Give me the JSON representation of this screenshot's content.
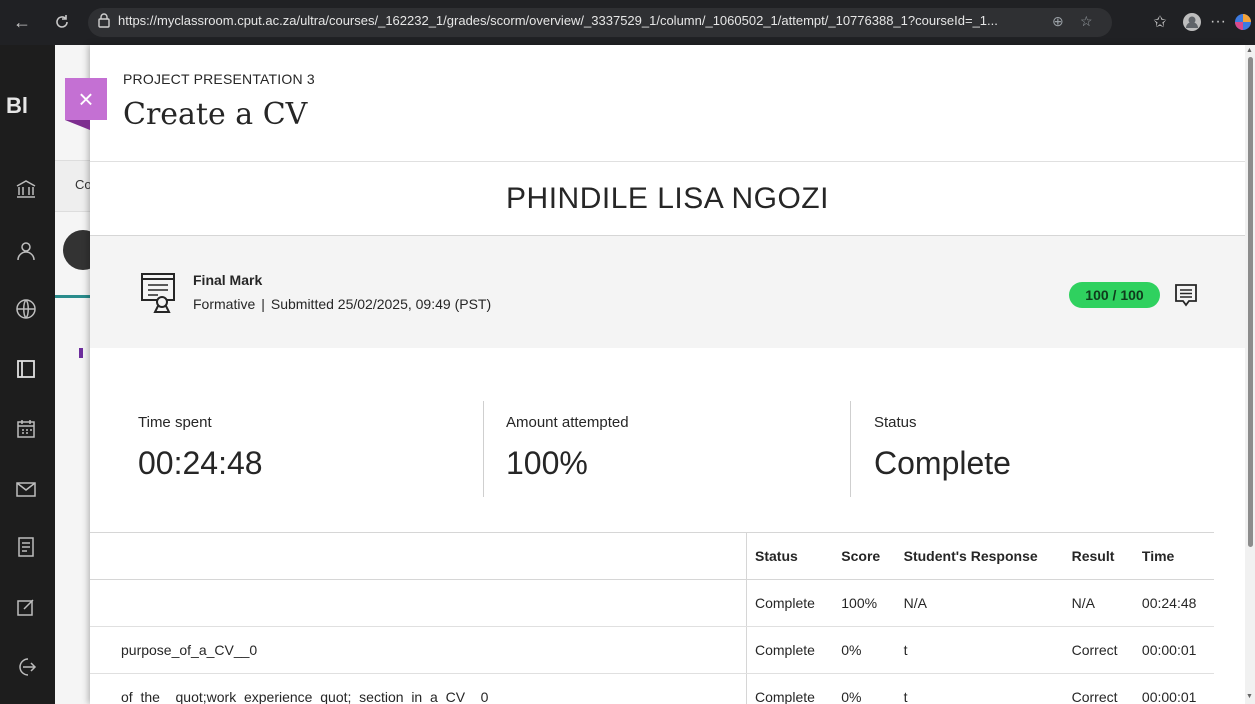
{
  "browser": {
    "url": "https://myclassroom.cput.ac.za/ultra/courses/_162232_1/grades/scorm/overview/_3337529_1/column/_1060502_1/attempt/_10776388_1?courseId=_1...",
    "back_icon": "back-arrow-icon",
    "refresh_icon": "refresh-icon",
    "lock_icon": "lock-icon"
  },
  "sidebar": {
    "logo": "Bl",
    "icons": [
      "institution-icon",
      "profile-icon",
      "globe-icon",
      "courses-icon",
      "calendar-icon",
      "messages-icon",
      "grades-icon",
      "tools-icon",
      "signout-icon"
    ]
  },
  "background_page": {
    "tab_text": "Co"
  },
  "panel": {
    "breadcrumb": "PROJECT PRESENTATION 3",
    "title": "Create a CV",
    "close_label": "×",
    "student_name": "PHINDILE LISA NGOZI",
    "grade": {
      "label": "Final Mark",
      "type": "Formative",
      "submitted": "Submitted 25/02/2025, 09:49 (PST)",
      "score": "100 / 100"
    },
    "stats": [
      {
        "label": "Time spent",
        "value": "00:24:48"
      },
      {
        "label": "Amount attempted",
        "value": "100%"
      },
      {
        "label": "Status",
        "value": "Complete"
      }
    ],
    "table": {
      "headers": [
        "",
        "Status",
        "Score",
        "Student's Response",
        "Result",
        "Time"
      ],
      "rows": [
        [
          "",
          "Complete",
          "100%",
          "N/A",
          "N/A",
          "00:24:48"
        ],
        [
          "purpose_of_a_CV__0",
          "Complete",
          "0%",
          "t",
          "Correct",
          "00:00:01"
        ],
        [
          "of_the__quot;work_experience_quot;_section_in_a_CV__0",
          "Complete",
          "0%",
          "t",
          "Correct",
          "00:00:01"
        ]
      ]
    }
  },
  "colors": {
    "score_pill": "#2fd15f",
    "close_tab": "#c470d3",
    "sidebar": "#1d1d1d"
  }
}
